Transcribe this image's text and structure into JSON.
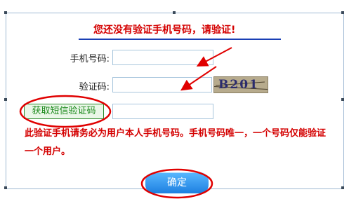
{
  "dialog": {
    "title": "您还没有验证手机号码，请验证!",
    "phone_label": "手机号码:",
    "code_label": "验证码:",
    "phone_value": "",
    "code_value": "",
    "sms_code_value": "",
    "captcha_text": "B201",
    "sms_button_label": "获取短信验证码",
    "note": "此验证手机请务必为用户本人手机号码。手机号码唯一，一个号码仅能验证一个用户。",
    "ok_button_label": "确定"
  },
  "colors": {
    "warning_red": "#d40000",
    "underline_blue": "#1a3fb5",
    "button_blue": "#1d7fe0",
    "sms_green": "#1c8a1c"
  }
}
